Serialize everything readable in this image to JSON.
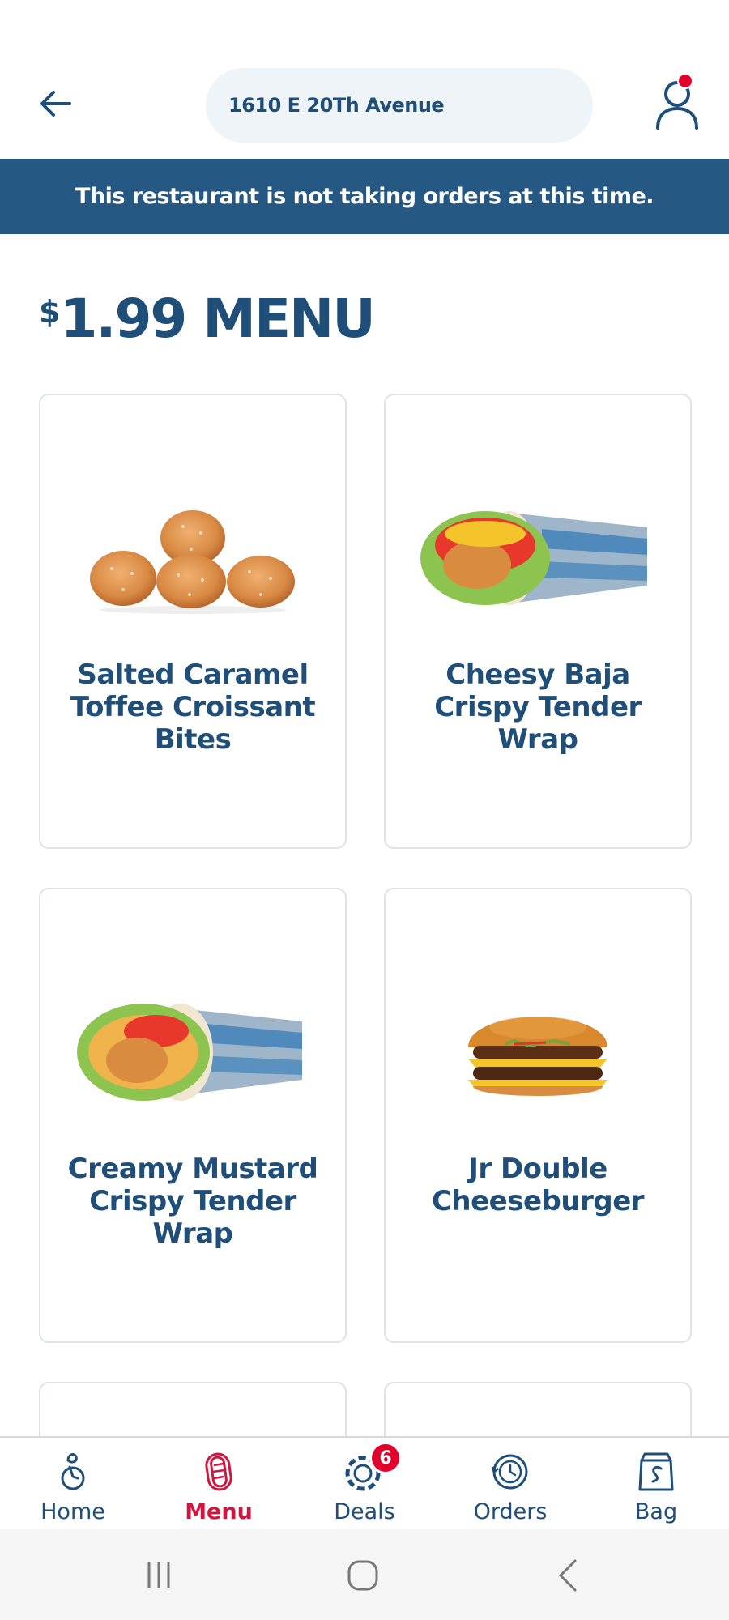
{
  "header": {
    "address": "1610 E 20Th Avenue"
  },
  "banner": {
    "message": "This restaurant is not taking orders at this time."
  },
  "menu": {
    "title_dollar": "$",
    "title_rest": "1.99 MENU",
    "items": [
      {
        "name": "Salted Caramel Toffee Croissant Bites",
        "icon": "croissant-bites-image"
      },
      {
        "name": "Cheesy Baja Crispy Tender Wrap",
        "icon": "wrap-image"
      },
      {
        "name": "Creamy Mustard Crispy Tender Wrap",
        "icon": "wrap-image"
      },
      {
        "name": "Jr Double Cheeseburger",
        "icon": "cheeseburger-image"
      }
    ]
  },
  "nav": {
    "items": [
      {
        "label": "Home",
        "icon": "home-icon"
      },
      {
        "label": "Menu",
        "icon": "hotdog-icon",
        "active": true
      },
      {
        "label": "Deals",
        "icon": "deals-icon"
      },
      {
        "label": "Orders",
        "icon": "orders-icon"
      },
      {
        "label": "Bag",
        "icon": "bag-icon"
      }
    ],
    "deals_badge": "6"
  },
  "colors": {
    "brand_blue": "#1f4e79",
    "banner_blue": "#265884",
    "active_red": "#d0163e",
    "badge_red": "#e3002b"
  }
}
